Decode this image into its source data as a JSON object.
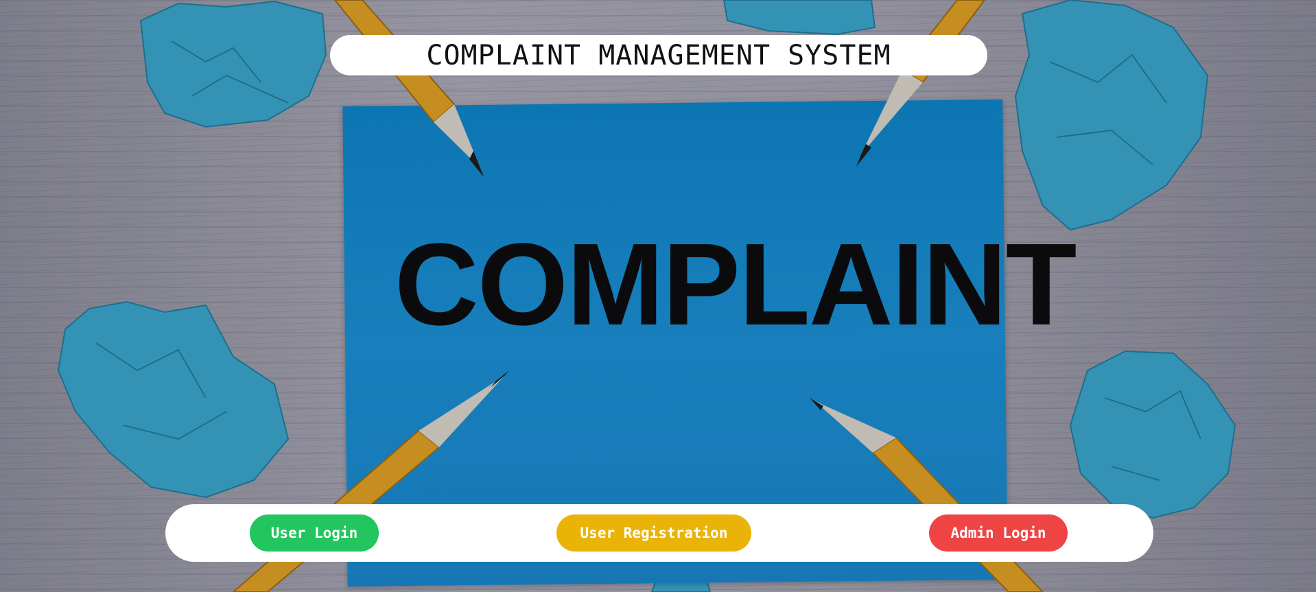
{
  "header": {
    "title": "COMPLAINT MANAGEMENT SYSTEM"
  },
  "hero": {
    "card_word": "COMPLAINT"
  },
  "actions": {
    "user_login": {
      "label": "User Login",
      "color": "#22c55e"
    },
    "user_registration": {
      "label": "User Registration",
      "color": "#eab308"
    },
    "admin_login": {
      "label": "Admin Login",
      "color": "#ef4444"
    }
  }
}
